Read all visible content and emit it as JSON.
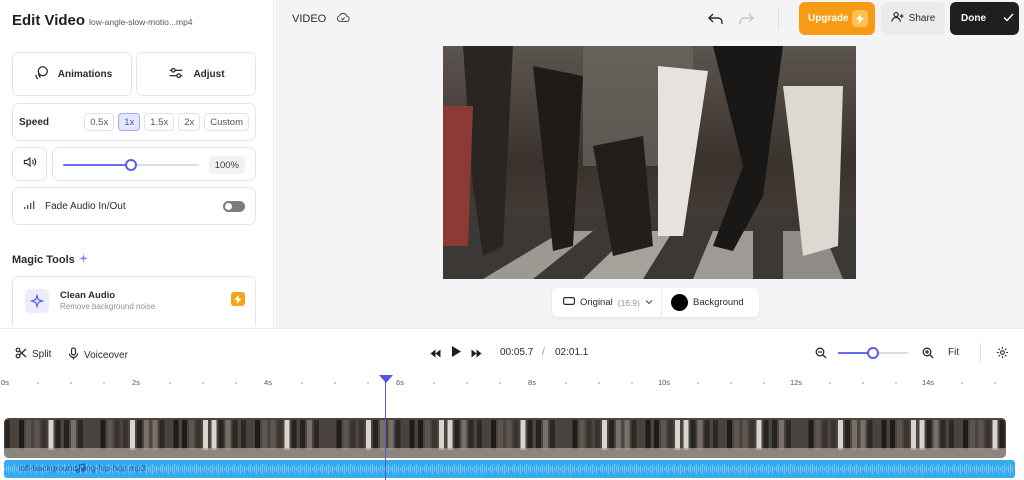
{
  "editor": {
    "title": "Edit Video",
    "filename": "low-angle-slow-motio...mp4"
  },
  "panel": {
    "animations_label": "Animations",
    "adjust_label": "Adjust",
    "speed": {
      "label": "Speed",
      "options": [
        "0.5x",
        "1x",
        "1.5x",
        "2x",
        "Custom"
      ],
      "selected": "1x"
    },
    "volume": {
      "value": 100,
      "display": "100%"
    },
    "fade": {
      "label": "Fade Audio In/Out",
      "enabled": false
    },
    "magic_tools": {
      "title": "Magic Tools",
      "clean_audio": {
        "title": "Clean Audio",
        "subtitle": "Remove background noise"
      }
    }
  },
  "topbar": {
    "media_type": "VIDEO",
    "upgrade_label": "Upgrade",
    "share_label": "Share",
    "done_label": "Done"
  },
  "canvas": {
    "aspect_label": "Original",
    "aspect_ratio": "(16:9)",
    "background_label": "Background",
    "background_color": "#000000"
  },
  "timeline": {
    "split_label": "Split",
    "voiceover_label": "Voiceover",
    "current_time": "00:05.7",
    "separator": "/",
    "total_time": "02:01.1",
    "fit_label": "Fit",
    "zoom_level": 0.5,
    "ruler_labels": [
      "0s",
      "2s",
      "4s",
      "6s",
      "8s",
      "10s",
      "12s",
      "14s"
    ],
    "audio_track_name": "lofi-background-vlog-hip-hop.mp3"
  },
  "colors": {
    "accent": "#5c5ee6",
    "upgrade": "#f79a14",
    "done": "#1f1f22",
    "audio_track": "#35aaf0"
  }
}
